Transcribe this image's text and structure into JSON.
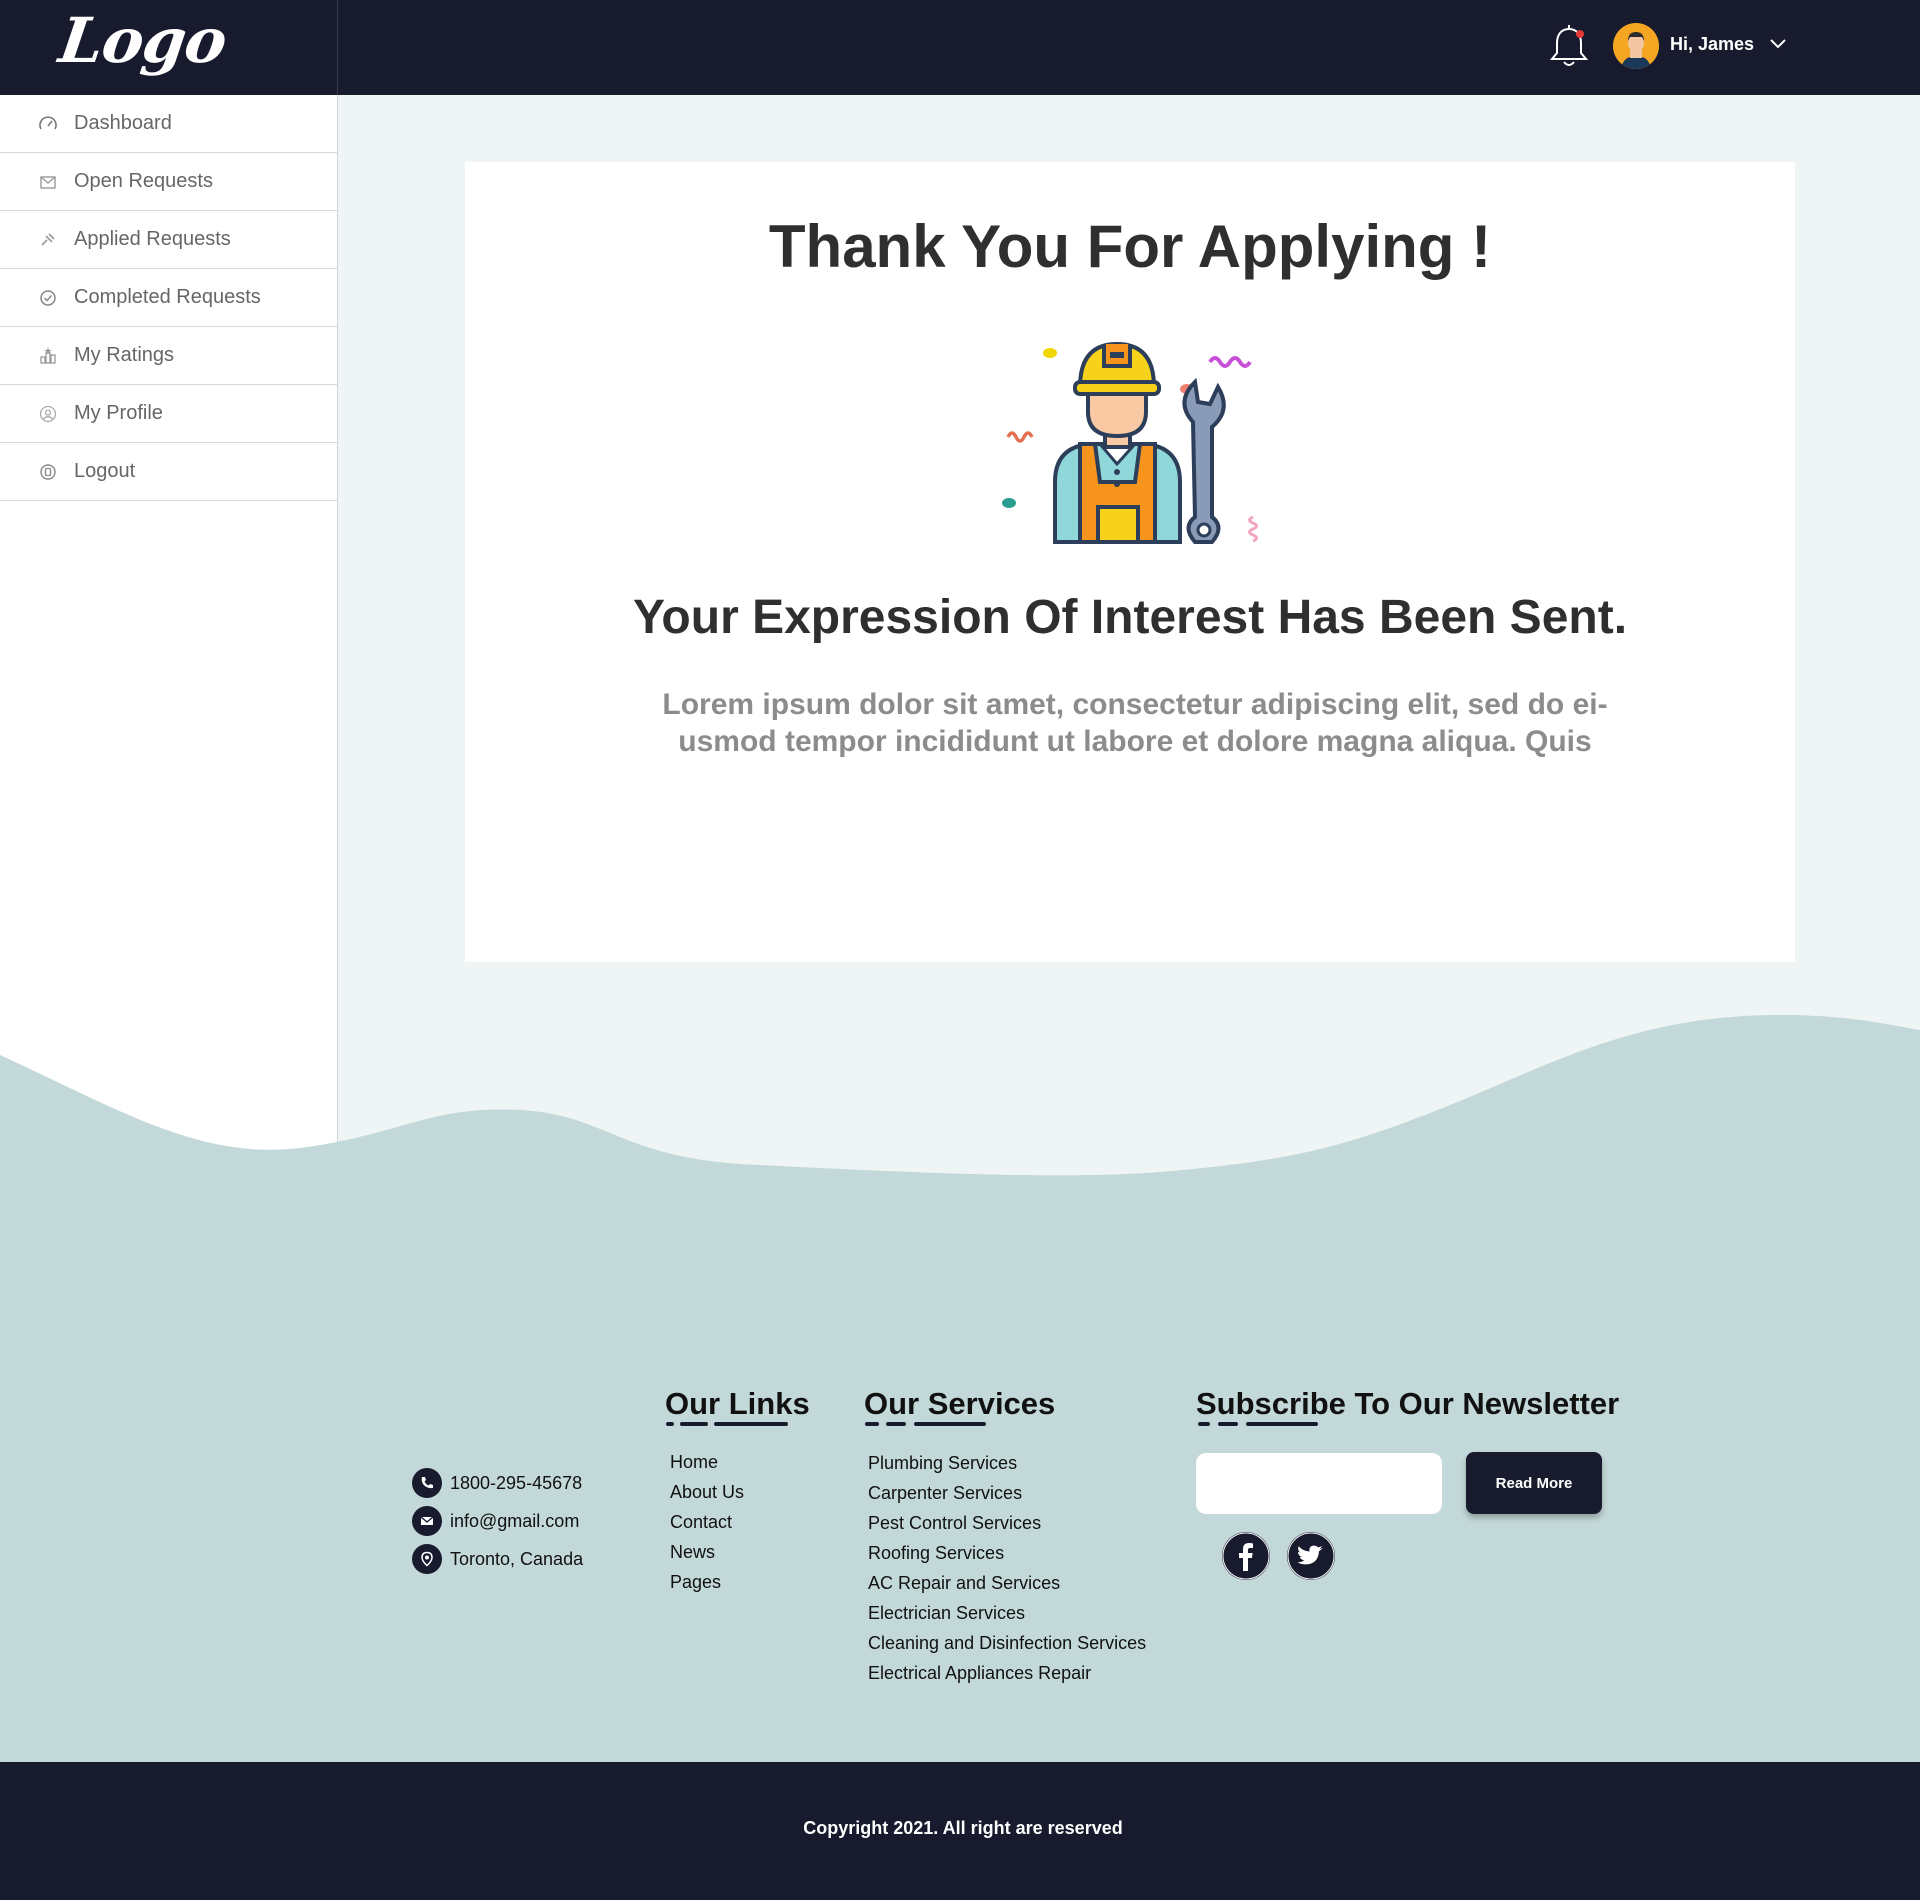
{
  "header": {
    "logo": "Logo",
    "greeting": "Hi, James"
  },
  "sidebar": {
    "items": [
      {
        "label": "Dashboard",
        "icon": "dashboard-icon"
      },
      {
        "label": "Open Requests",
        "icon": "open-requests-icon"
      },
      {
        "label": "Applied Requests",
        "icon": "applied-requests-icon"
      },
      {
        "label": "Completed Requests",
        "icon": "check-circle-icon"
      },
      {
        "label": "My Ratings",
        "icon": "ratings-icon"
      },
      {
        "label": "My Profile",
        "icon": "profile-icon"
      },
      {
        "label": "Logout",
        "icon": "logout-icon"
      }
    ]
  },
  "main": {
    "title": "Thank You For Applying !",
    "subtitle": "Your Expression Of Interest Has Been Sent.",
    "body": "Lorem ipsum dolor sit amet, consectetur adipiscing elit, sed do ei-usmod tempor incididunt ut labore et dolore magna aliqua. Quis"
  },
  "footer": {
    "contact": {
      "phone": "1800-295-45678",
      "email": "info@gmail.com",
      "location": "Toronto, Canada"
    },
    "links": {
      "title": "Our Links",
      "items": [
        "Home",
        "About Us",
        "Contact",
        "News",
        "Pages"
      ]
    },
    "services": {
      "title": "Our Services",
      "items": [
        "Plumbing Services",
        "Carpenter Services",
        "Pest Control Services",
        "Roofing Services",
        "AC Repair and Services",
        "Electrician Services",
        "Cleaning and Disinfection Services",
        "Electrical Appliances Repair"
      ]
    },
    "newsletter": {
      "title": "Subscribe To Our Newsletter",
      "input_placeholder": "",
      "button": "Read More"
    },
    "copyright": "Copyright 2021. All right are reserved"
  },
  "colors": {
    "dark": "#181a2d",
    "page_bg": "#eff5f4",
    "wave": "#c3d8d8",
    "accent_orange": "#f5a623"
  }
}
